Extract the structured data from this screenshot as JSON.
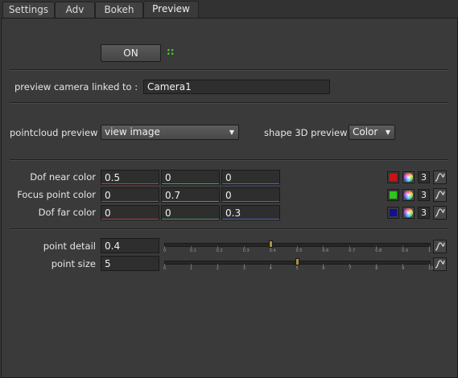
{
  "tabs": [
    {
      "label": "Settings"
    },
    {
      "label": "Adv"
    },
    {
      "label": "Bokeh"
    },
    {
      "label": "Preview"
    }
  ],
  "preview": {
    "on_button": "ON",
    "on_indicator": "::",
    "camera_label": "preview camera linked to :",
    "camera_value": "Camera1",
    "pointcloud_label": "pointcloud preview",
    "pointcloud_value": "view image",
    "shape_label": "shape 3D preview",
    "shape_value": "Color"
  },
  "colors": [
    {
      "label": "Dof near color",
      "r": "0.5",
      "g": "0",
      "b": "0",
      "swatch": "#c81414",
      "count": "3"
    },
    {
      "label": "Focus point color",
      "r": "0",
      "g": "0.7",
      "b": "0",
      "swatch": "#2cc81a",
      "count": "3"
    },
    {
      "label": "Dof far color",
      "r": "0",
      "g": "0",
      "b": "0.3",
      "swatch": "#101090",
      "count": "3"
    }
  ],
  "sliders": [
    {
      "label": "point detail",
      "value": "0.4",
      "level": 0.4,
      "ticks": [
        "0",
        "0.1",
        "0.2",
        "0.3",
        "0.4",
        "0.5",
        "0.6",
        "0.7",
        "0.8",
        "0.9",
        "1"
      ]
    },
    {
      "label": "point size",
      "value": "5",
      "level": 0.5,
      "ticks": [
        "0",
        "1",
        "2",
        "3",
        "4",
        "5",
        "6",
        "7",
        "8",
        "9",
        "10"
      ]
    }
  ],
  "accent": {
    "indicator": "#4ccf2a",
    "handle": "#b09040"
  }
}
